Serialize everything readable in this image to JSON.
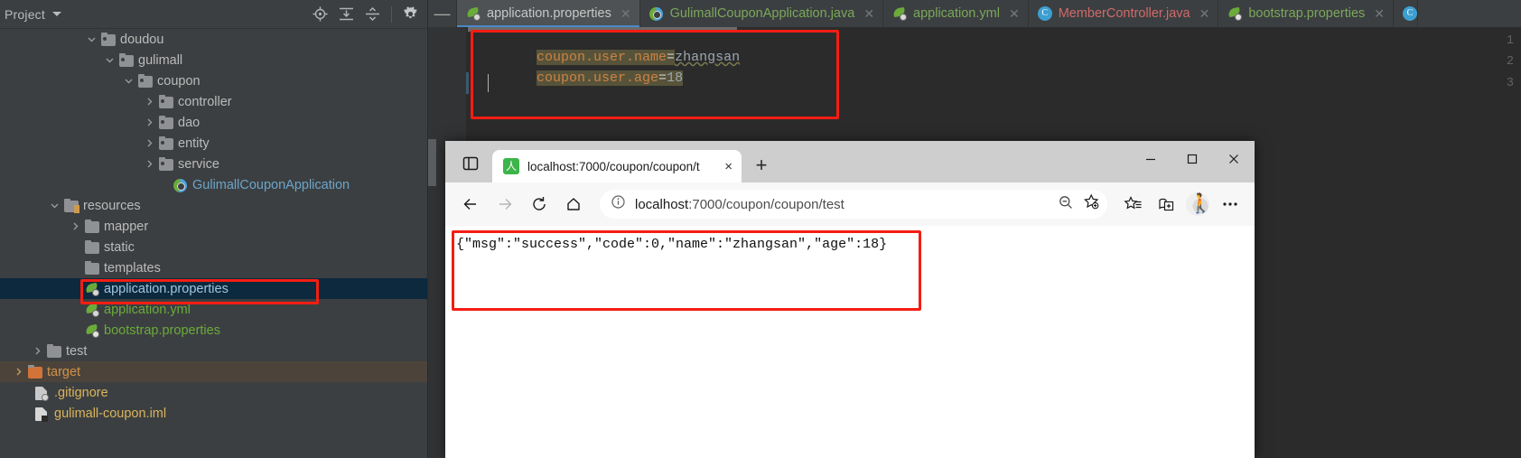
{
  "ide": {
    "project_panel": {
      "title": "Project",
      "header_icons": [
        {
          "name": "locate-icon"
        },
        {
          "name": "expand-all-icon"
        },
        {
          "name": "collapse-all-icon"
        },
        {
          "name": "gear-icon"
        }
      ],
      "tree": [
        {
          "label": "doudou",
          "icon": "folder-icon",
          "arrow": "down",
          "indent": 0,
          "style": "plain"
        },
        {
          "label": "gulimall",
          "icon": "folder-icon",
          "arrow": "down",
          "indent": 1,
          "style": "plain"
        },
        {
          "label": "coupon",
          "icon": "folder-icon",
          "arrow": "down",
          "indent": 2,
          "style": "plain"
        },
        {
          "label": "controller",
          "icon": "folder-icon",
          "arrow": "right",
          "indent": 3,
          "style": "plain"
        },
        {
          "label": "dao",
          "icon": "folder-icon",
          "arrow": "right",
          "indent": 3,
          "style": "plain"
        },
        {
          "label": "entity",
          "icon": "folder-icon",
          "arrow": "right",
          "indent": 3,
          "style": "plain"
        },
        {
          "label": "service",
          "icon": "folder-icon",
          "arrow": "right",
          "indent": 3,
          "style": "plain"
        },
        {
          "label": "GulimallCouponApplication",
          "icon": "spring-boot-app-icon",
          "arrow": "none",
          "indent": 4,
          "style": "blue"
        },
        {
          "label": "resources",
          "icon": "resources-folder-icon",
          "arrow": "down",
          "indent": 1,
          "style": "plain"
        },
        {
          "label": "mapper",
          "icon": "folder-plain-icon",
          "arrow": "right",
          "indent": 2,
          "style": "plain"
        },
        {
          "label": "static",
          "icon": "folder-plain-icon",
          "arrow": "none",
          "indent": 2,
          "style": "plain"
        },
        {
          "label": "templates",
          "icon": "folder-plain-icon",
          "arrow": "none",
          "indent": 2,
          "style": "plain"
        },
        {
          "label": "application.properties",
          "icon": "spring-config-icon",
          "arrow": "none",
          "indent": 2,
          "style": "selected-file",
          "selected": true,
          "highlighted": true
        },
        {
          "label": "application.yml",
          "icon": "spring-config-icon",
          "arrow": "none",
          "indent": 2,
          "style": "spring"
        },
        {
          "label": "bootstrap.properties",
          "icon": "spring-cloud-config-icon",
          "arrow": "none",
          "indent": 2,
          "style": "spring"
        },
        {
          "label": "test",
          "icon": "folder-plain-icon",
          "arrow": "right",
          "indent": 1,
          "style": "plain"
        },
        {
          "label": "target",
          "icon": "folder-orange-icon",
          "arrow": "right",
          "indent": 0,
          "style": "orange",
          "row_highlight": true
        },
        {
          "label": ".gitignore",
          "icon": "gitignore-file-icon",
          "arrow": "none",
          "indent": 0,
          "style": "yellow"
        },
        {
          "label": "gulimall-coupon.iml",
          "icon": "iml-file-icon",
          "arrow": "none",
          "indent": 0,
          "style": "yellow"
        }
      ]
    },
    "tabs": [
      {
        "label": "application.properties",
        "icon": "spring-config-icon",
        "style": "active",
        "closable": true
      },
      {
        "label": "GulimallCouponApplication.java",
        "icon": "spring-boot-app-icon",
        "style": "spring",
        "closable": true
      },
      {
        "label": "application.yml",
        "icon": "spring-config-icon",
        "style": "spring",
        "closable": true
      },
      {
        "label": "MemberController.java",
        "icon": "java-class-icon",
        "style": "java",
        "closable": true
      },
      {
        "label": "bootstrap.properties",
        "icon": "spring-cloud-config-icon",
        "style": "spring",
        "closable": true
      }
    ],
    "tabstrip_minimize_label": "—",
    "editor": {
      "line_numbers": [
        "1",
        "2",
        "3"
      ],
      "lines": [
        {
          "key": "coupon.user.name",
          "eq": "=",
          "value": "zhangsan",
          "value_kind": "string-warn"
        },
        {
          "key": "coupon.user.age",
          "eq": "=",
          "value": "18",
          "value_kind": "number"
        },
        {
          "key": "",
          "eq": "",
          "value": "",
          "value_kind": "empty"
        }
      ]
    }
  },
  "browser": {
    "tab": {
      "title": "localhost:7000/coupon/coupon/t",
      "favicon_letter": "人",
      "close_label": "×"
    },
    "new_tab_label": "+",
    "window_controls": {
      "minimize": "—",
      "maximize": "❐",
      "close": "✕"
    },
    "toolbar": {
      "back": "back-arrow",
      "forward": "forward-arrow",
      "reload": "reload",
      "home": "home",
      "url": "localhost:7000/coupon/coupon/test",
      "url_host": "localhost",
      "url_path": ":7000/coupon/coupon/test",
      "info_icon": "info-icon",
      "zoom_out_icon": "zoom-out-icon",
      "favorite_icon": "add-favorite-icon",
      "favorites_icon": "favorites-list-icon",
      "collections_icon": "collections-icon",
      "profile_icon": "profile-avatar",
      "more_icon": "more-options"
    },
    "page": {
      "response": "{\"msg\":\"success\",\"code\":0,\"name\":\"zhangsan\",\"age\":18}"
    }
  },
  "annotations": {
    "accent_red": "#f41d13",
    "boxes": [
      {
        "name": "editor-code-highlight-box"
      },
      {
        "name": "sidebar-file-highlight-box"
      },
      {
        "name": "browser-response-highlight-box"
      }
    ]
  }
}
